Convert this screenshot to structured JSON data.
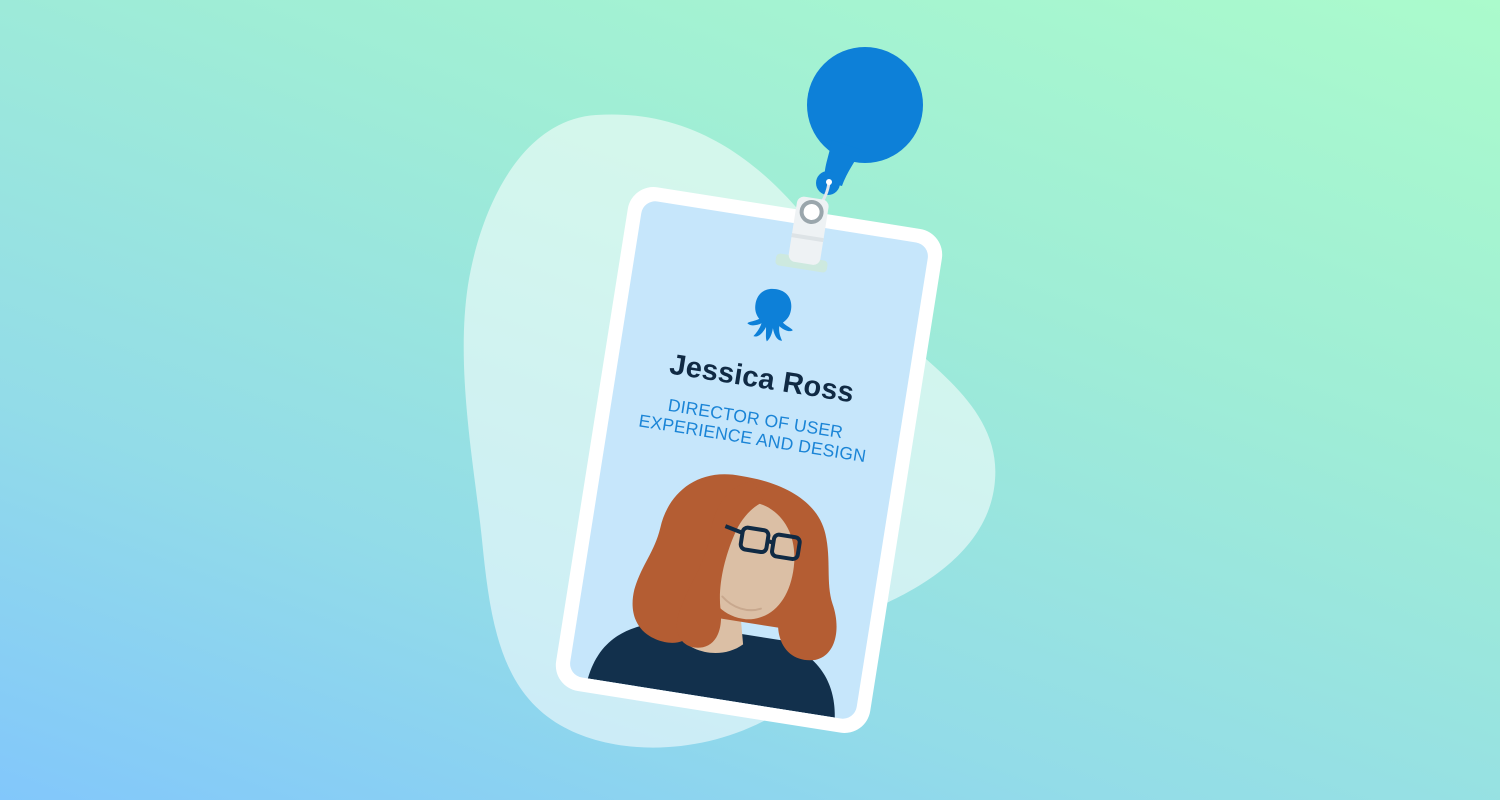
{
  "badge": {
    "name": "Jessica Ross",
    "title_line1": "DIRECTOR OF USER",
    "title_line2": "EXPERIENCE AND DESIGN"
  },
  "icons": {
    "logo": "octopus-icon",
    "reel": "badge-reel-icon",
    "clip": "badge-clip-icon"
  },
  "colors": {
    "brand_blue": "#0d80d8",
    "card_background": "#c6e6fb",
    "name_text": "#102a44",
    "title_text": "#1a84d6",
    "hair": "#b45d33",
    "skin": "#dbbfa5",
    "shirt": "#12304c"
  }
}
